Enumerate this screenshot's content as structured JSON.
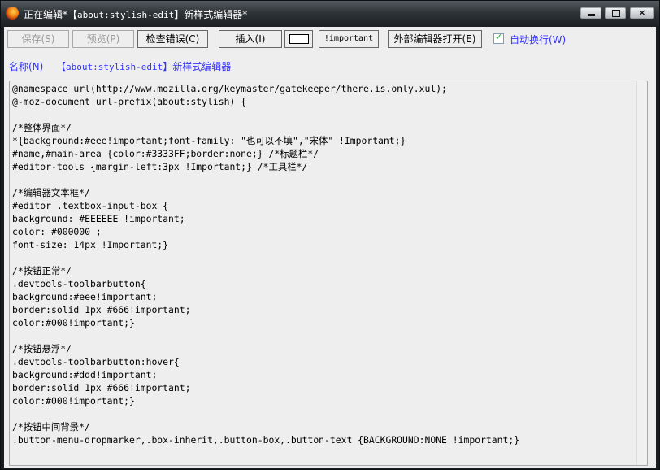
{
  "window": {
    "title_prefix": "正在编辑*【",
    "title_url": "about:stylish-edit",
    "title_suffix": "】新样式编辑器*",
    "min_label": "",
    "max_label": "",
    "close_label": "×"
  },
  "toolbar": {
    "save_label": "保存(S)",
    "preview_label": "预览(P)",
    "check_errors_label": "检查错误(C)",
    "insert_label": "插入(I)",
    "important_label": "!important",
    "external_editor_label": "外部编辑器打开(E)",
    "auto_wrap_label": "自动换行(W)",
    "auto_wrap_checked": true,
    "swatch_color": "#ffffff"
  },
  "name_field": {
    "label": "名称(N)",
    "value_prefix": "【",
    "value_url": "about:stylish-edit",
    "value_suffix": "】新样式编辑器"
  },
  "editor": {
    "code": "@namespace url(http://www.mozilla.org/keymaster/gatekeeper/there.is.only.xul);\n@-moz-document url-prefix(about:stylish) {\n\n/*整体界面*/\n*{background:#eee!important;font-family: \"也可以不填\",\"宋体\" !Important;}\n#name,#main-area {color:#3333FF;border:none;} /*标题栏*/\n#editor-tools {margin-left:3px !Important;} /*工具栏*/\n\n/*编辑器文本框*/\n#editor .textbox-input-box {\nbackground: #EEEEEE !important;\ncolor: #000000 ;\nfont-size: 14px !Important;}\n\n/*按钮正常*/\n.devtools-toolbarbutton{\nbackground:#eee!important;\nborder:solid 1px #666!important;\ncolor:#000!important;}\n\n/*按钮悬浮*/\n.devtools-toolbarbutton:hover{\nbackground:#ddd!important;\nborder:solid 1px #666!important;\ncolor:#000!important;}\n\n/*按钮中间背景*/\n.button-menu-dropmarker,.box-inherit,.button-box,.button-text {BACKGROUND:NONE !important;}"
  },
  "colors": {
    "editor_background": "#EEEEEE",
    "label_blue": "#3333FF",
    "button_border": "#666666"
  }
}
